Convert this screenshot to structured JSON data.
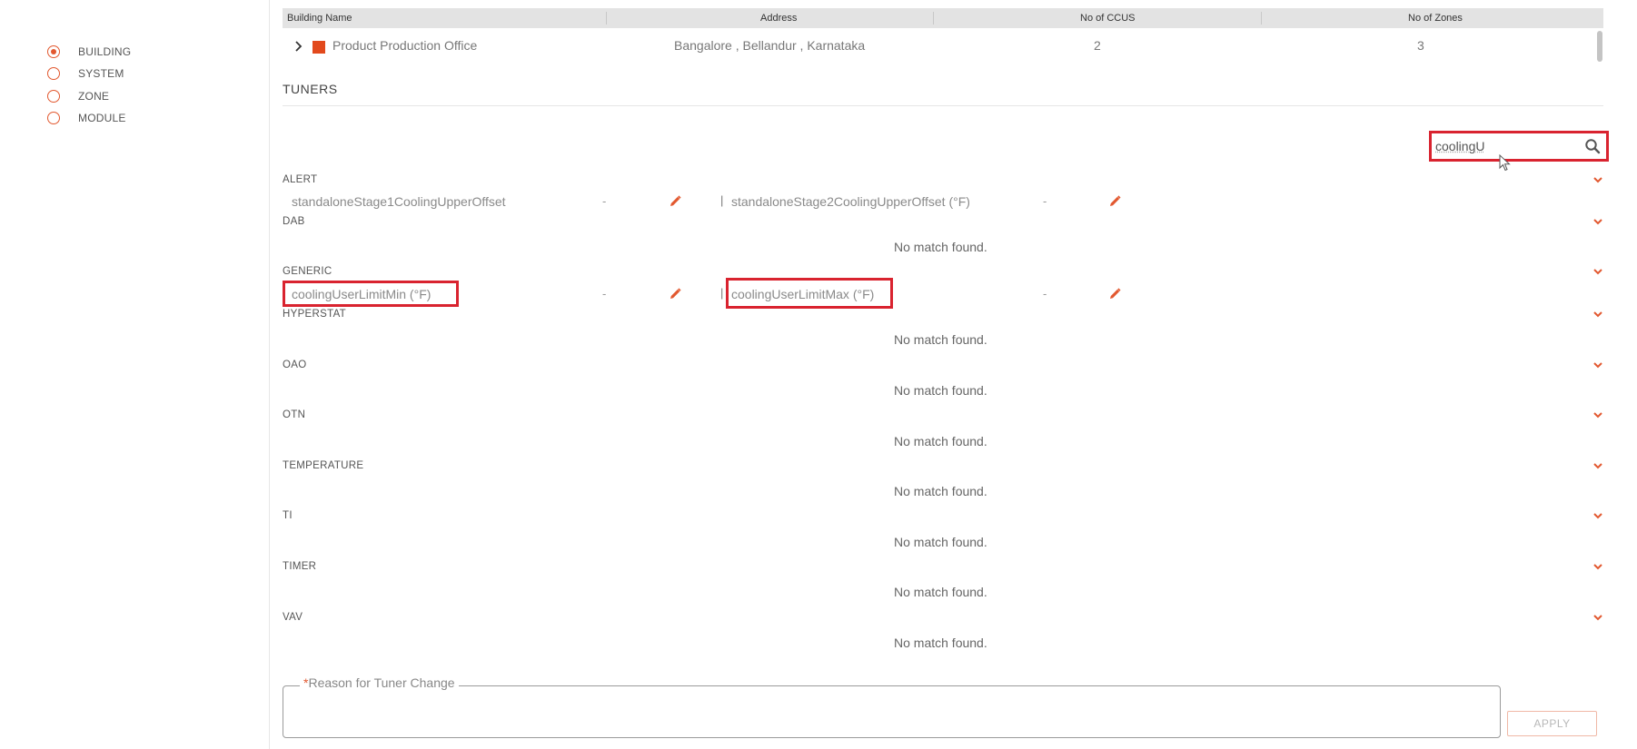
{
  "nav": {
    "items": [
      {
        "label": "BUILDING",
        "checked": true
      },
      {
        "label": "SYSTEM",
        "checked": false
      },
      {
        "label": "ZONE",
        "checked": false
      },
      {
        "label": "MODULE",
        "checked": false
      }
    ]
  },
  "building_table": {
    "headers": [
      "Building Name",
      "Address",
      "No of CCUS",
      "No of Zones"
    ],
    "row": {
      "name": "Product Production Office",
      "address": "Bangalore , Bellandur , Karnataka",
      "ccus": "2",
      "zones": "3"
    }
  },
  "tuners": {
    "title": "TUNERS",
    "search_value": "coolingU",
    "groups": [
      {
        "label": "ALERT",
        "tuners": [
          {
            "name": "standaloneStage1CoolingUpperOffset",
            "value": "-"
          },
          {
            "name": "standaloneStage2CoolingUpperOffset (°F)",
            "value": "-"
          }
        ]
      },
      {
        "label": "DAB",
        "empty_text": "No match found."
      },
      {
        "label": "GENERIC",
        "tuners": [
          {
            "name": "coolingUserLimitMin (°F)",
            "value": "-"
          },
          {
            "name": "coolingUserLimitMax (°F)",
            "value": "-"
          }
        ]
      },
      {
        "label": "HYPERSTAT",
        "empty_text": "No match found."
      },
      {
        "label": "OAO",
        "empty_text": "No match found."
      },
      {
        "label": "OTN",
        "empty_text": "No match found."
      },
      {
        "label": "TEMPERATURE",
        "empty_text": "No match found."
      },
      {
        "label": "TI",
        "empty_text": "No match found."
      },
      {
        "label": "TIMER",
        "empty_text": "No match found."
      },
      {
        "label": "VAV",
        "empty_text": "No match found."
      }
    ],
    "separator": "|"
  },
  "reason": {
    "required_mark": "*",
    "label": "Reason for Tuner Change"
  },
  "apply_label": "APPLY",
  "colors": {
    "accent": "#e2582f",
    "highlight": "#d9232f"
  }
}
